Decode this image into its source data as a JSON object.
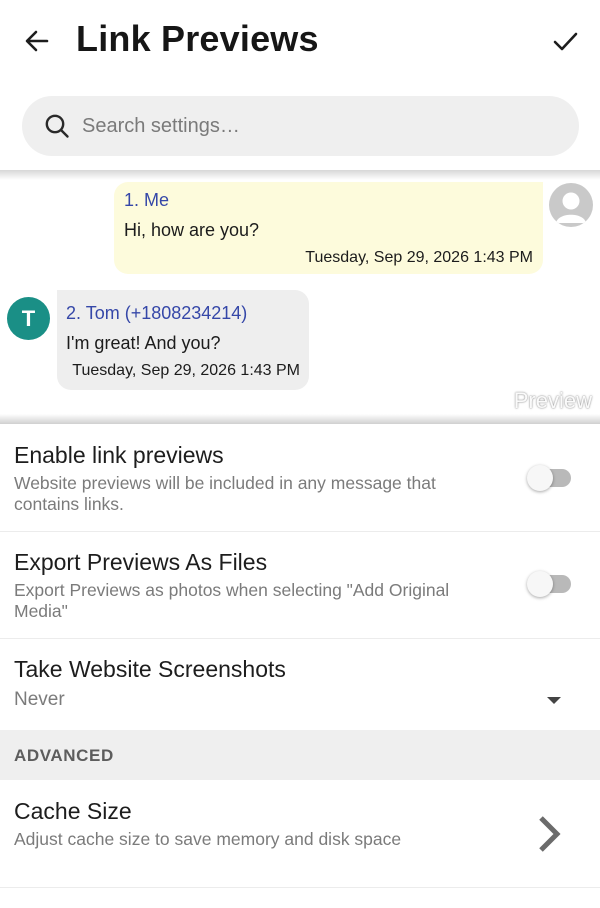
{
  "header": {
    "title": "Link Previews",
    "back_icon": "arrow-left-icon",
    "confirm_icon": "check-icon"
  },
  "search": {
    "placeholder": "Search settings…",
    "value": ""
  },
  "preview": {
    "messages": [
      {
        "name": "1. Me",
        "text": "Hi, how are you?",
        "time": "Tuesday, Sep 29, 2026 1:43 PM"
      },
      {
        "name": "2. Tom (+1808234214)",
        "text": "I'm great! And you?",
        "time": "Tuesday, Sep 29, 2026 1:43 PM",
        "avatar_letter": "T"
      }
    ],
    "label": "Preview"
  },
  "settings": {
    "enable_link_previews": {
      "title": "Enable link previews",
      "subtitle": "Website previews will be included in any message that contains links.",
      "enabled": false
    },
    "export_previews": {
      "title": "Export Previews As Files",
      "subtitle": "Export Previews as photos when selecting \"Add Original Media\"",
      "enabled": false
    },
    "website_screenshots": {
      "title": "Take Website Screenshots",
      "value": "Never"
    },
    "advanced_header": "ADVANCED",
    "cache_size": {
      "title": "Cache Size",
      "subtitle": "Adjust cache size to save memory and disk space"
    }
  },
  "colors": {
    "accent_name": "#3547a8",
    "bubble_me": "#fdfbdc",
    "bubble_other": "#eeeeee",
    "avatar_tom": "#1a8f86"
  }
}
